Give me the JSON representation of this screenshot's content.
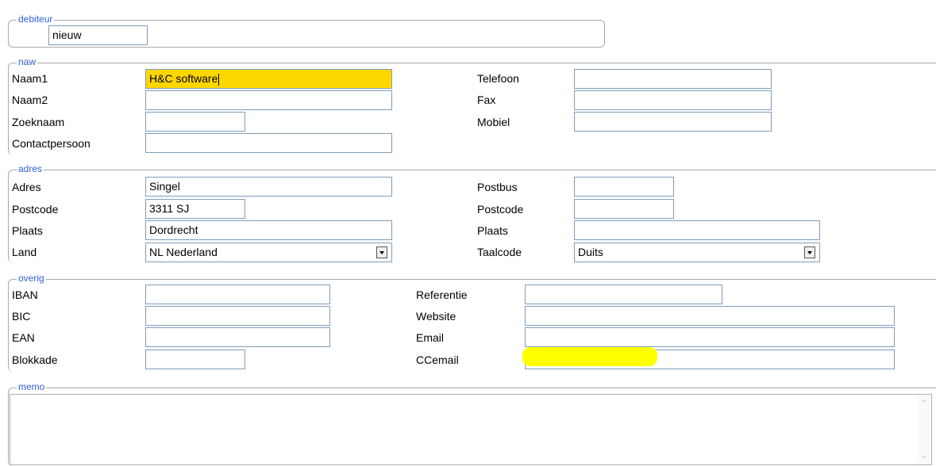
{
  "debiteur": {
    "legend": "debiteur",
    "number_value": "nieuw"
  },
  "naw": {
    "legend": "naw",
    "naam1_label": "Naam1",
    "naam1_value": "H&C software",
    "naam2_label": "Naam2",
    "naam2_value": "",
    "zoeknaam_label": "Zoeknaam",
    "zoeknaam_value": "",
    "contactpersoon_label": "Contactpersoon",
    "contactpersoon_value": "",
    "telefoon_label": "Telefoon",
    "telefoon_value": "",
    "fax_label": "Fax",
    "fax_value": "",
    "mobiel_label": "Mobiel",
    "mobiel_value": ""
  },
  "adres": {
    "legend": "adres",
    "adres_label": "Adres",
    "adres_value": "Singel",
    "postcode_label": "Postcode",
    "postcode_value": "3311 SJ",
    "plaats_label": "Plaats",
    "plaats_value": "Dordrecht",
    "land_label": "Land",
    "land_value": "NL Nederland",
    "postbus_label": "Postbus",
    "postbus_value": "",
    "postcode2_label": "Postcode",
    "postcode2_value": "",
    "plaats2_label": "Plaats",
    "plaats2_value": "",
    "taalcode_label": "Taalcode",
    "taalcode_value": "Duits"
  },
  "overig": {
    "legend": "overig",
    "iban_label": "IBAN",
    "iban_value": "",
    "bic_label": "BIC",
    "bic_value": "",
    "ean_label": "EAN",
    "ean_value": "",
    "blokkade_label": "Blokkade",
    "blokkade_value": "",
    "referentie_label": "Referentie",
    "referentie_value": "",
    "website_label": "Website",
    "website_value": "",
    "email_label": "Email",
    "email_value": "",
    "ccemail_label": "CCemail",
    "ccemail_value": ""
  },
  "memo": {
    "legend": "memo",
    "value": ""
  },
  "colors": {
    "legend_text": "#2f5fd4",
    "active_field": "#ffd700",
    "highlight_mark": "#ffff00",
    "field_border": "#7f9db9"
  }
}
